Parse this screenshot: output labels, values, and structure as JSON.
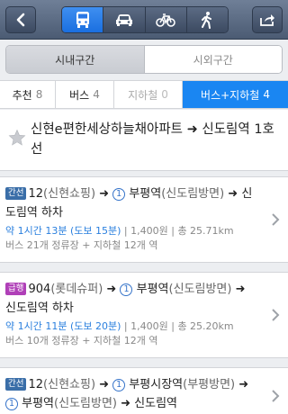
{
  "topbar": {
    "modes": [
      "bus-icon",
      "car-icon",
      "bicycle-icon",
      "walk-icon"
    ],
    "active_mode": "bus-icon"
  },
  "region": {
    "inner": "시내구간",
    "outer": "시외구간"
  },
  "tabs": [
    {
      "label": "추천",
      "count": "8"
    },
    {
      "label": "버스",
      "count": "4"
    },
    {
      "label": "지하철",
      "count": "0"
    },
    {
      "label": "버스+지하철",
      "count": "4"
    }
  ],
  "route": {
    "title": "신현e편한세상하늘채아파트 ➜ 신도림역 1호선"
  },
  "results": [
    {
      "badge": "간선",
      "bus": "12",
      "bus_stop": "(신현쇼핑)",
      "line_num": "1",
      "transfer": "부평역",
      "transfer_sub": "(신도림방면)",
      "dest": "신도림역 하차",
      "time": "약 1시간 13분 (도보 15분)",
      "fare": "1,400원",
      "distance": "총 25.71km",
      "stops": "버스 21개 정류장 + 지하철 12개 역"
    },
    {
      "badge": "급행",
      "bus": "904",
      "bus_stop": "(롯데슈퍼)",
      "line_num": "1",
      "transfer": "부평역",
      "transfer_sub": "(신도림방면)",
      "dest": "신도림역 하차",
      "time": "약 1시간 11분 (도보 20분)",
      "fare": "1,400원",
      "distance": "총 25.20km",
      "stops": "버스 10개 정류장 + 지하철 12개 역"
    },
    {
      "badge": "간선",
      "bus": "12",
      "bus_stop": "(신현쇼핑)",
      "line_num": "1",
      "transfer": "부평시장역",
      "transfer_sub": "(부평방면)",
      "line_num2": "1",
      "transfer2": "부평역",
      "transfer2_sub": "(신도림방면)",
      "dest": "신도림역"
    }
  ],
  "colors": {
    "accent": "#1a86f2",
    "badge_trunk": "#3a6ea8",
    "badge_express": "#b040b8"
  }
}
